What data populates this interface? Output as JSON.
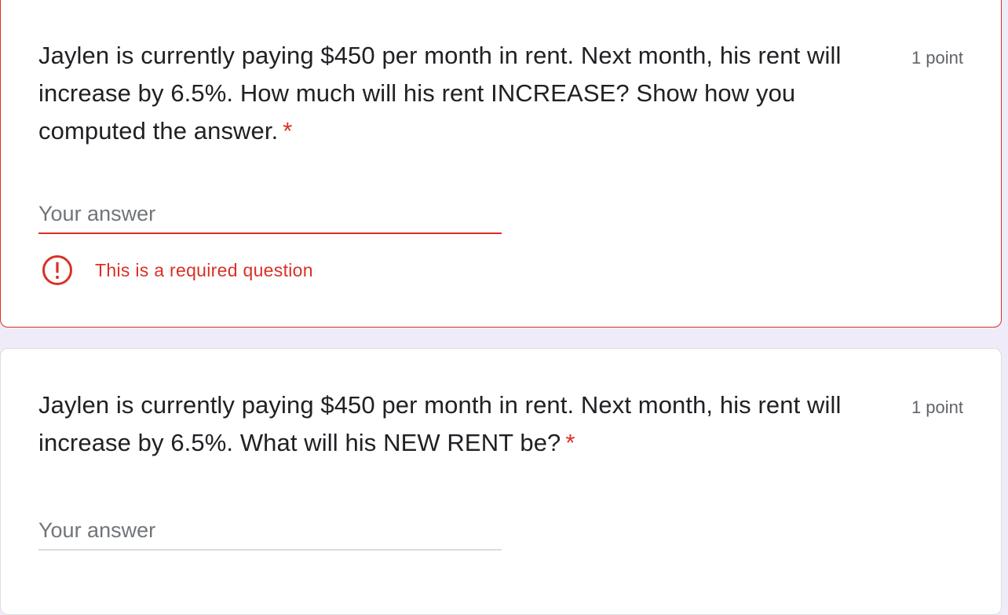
{
  "colors": {
    "page_background": "#f0ebf8",
    "error": "#d93025",
    "text": "#202124",
    "muted": "#5f6368",
    "divider": "#dadce0"
  },
  "questions": [
    {
      "text": "Jaylen is currently paying $450 per month in rent. Next month, his rent will increase by 6.5%. How much will his rent INCREASE? Show how you computed the answer.",
      "required_marker": "*",
      "points": "1 point",
      "answer": {
        "value": "",
        "placeholder": "Your answer"
      },
      "error": {
        "icon": "error-circle-icon",
        "message": "This is a required question"
      }
    },
    {
      "text": "Jaylen is currently paying $450 per month in rent. Next month, his rent will increase by 6.5%. What will his NEW RENT be?",
      "required_marker": "*",
      "points": "1 point",
      "answer": {
        "value": "",
        "placeholder": "Your answer"
      }
    }
  ]
}
